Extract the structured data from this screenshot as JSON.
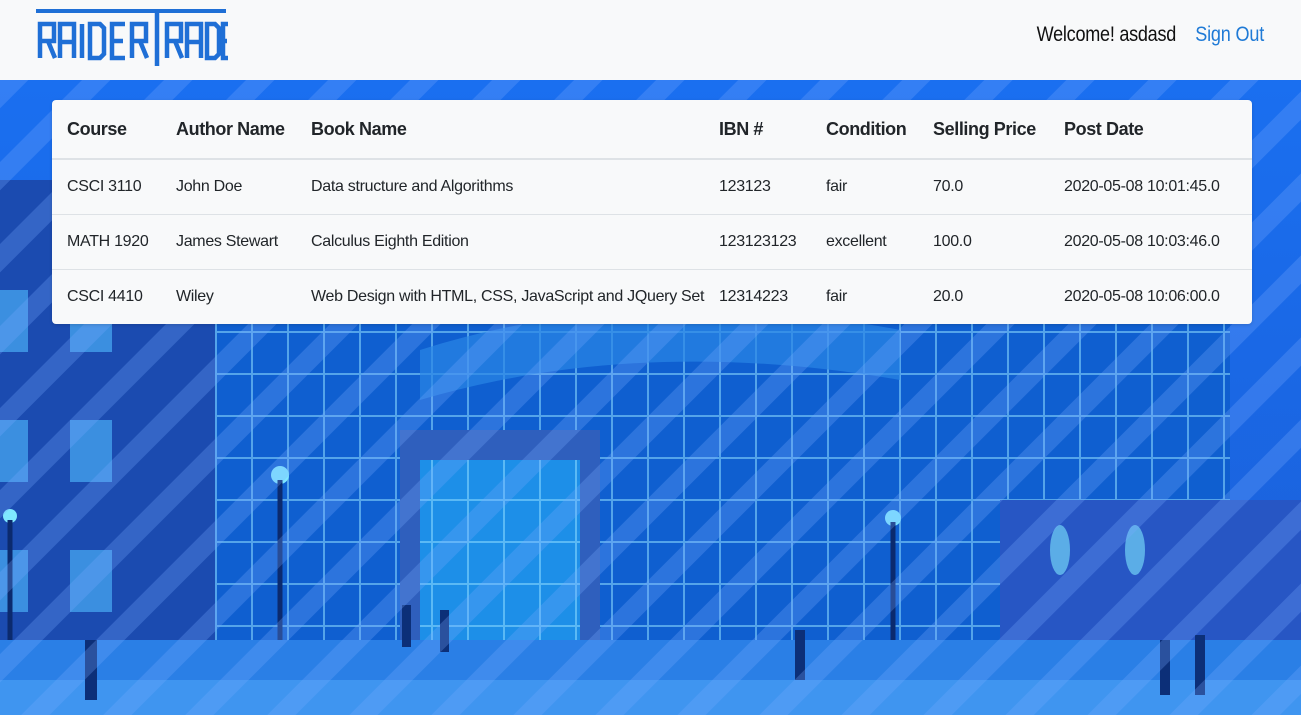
{
  "header": {
    "logo_text": "RAIDERTRADE",
    "welcome_text": "Welcome! asdasd",
    "signout_label": "Sign Out"
  },
  "table": {
    "columns": [
      "Course",
      "Author Name",
      "Book Name",
      "IBN #",
      "Condition",
      "Selling Price",
      "Post Date"
    ],
    "rows": [
      [
        "CSCI 3110",
        "John Doe",
        "Data structure and Algorithms",
        "123123",
        "fair",
        "70.0",
        "2020-05-08 10:01:45.0"
      ],
      [
        "MATH 1920",
        "James Stewart",
        "Calculus Eighth Edition",
        "123123123",
        "excellent",
        "100.0",
        "2020-05-08 10:03:46.0"
      ],
      [
        "CSCI 4410",
        "Wiley",
        "Web Design with HTML, CSS, JavaScript and JQuery Set",
        "12314223",
        "fair",
        "20.0",
        "2020-05-08 10:06:00.0"
      ]
    ]
  },
  "colors": {
    "brand_blue": "#1f6fd6",
    "overlay_blue": "#1f5fd6",
    "link_blue": "#1f7ad6",
    "card_bg": "#f8f9fa"
  }
}
